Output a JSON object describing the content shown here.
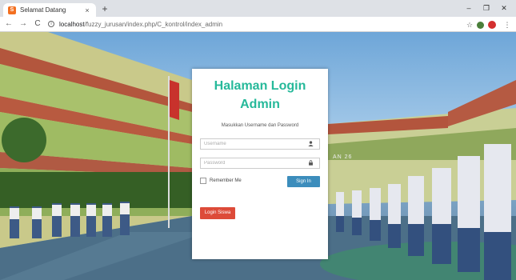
{
  "browser": {
    "tab": {
      "favicon": "S",
      "title": "Selamat Datang",
      "close": "×"
    },
    "new_tab": "+",
    "window": {
      "minimize": "–",
      "maximize": "❐",
      "close": "✕"
    },
    "nav": {
      "back": "←",
      "forward": "→",
      "reload": "C",
      "info": "i"
    },
    "url": {
      "host": "localhost",
      "path": "/fuzzy_jurusan/index.php/C_kontrol/index_admin"
    },
    "icons": {
      "star": "☆",
      "menu": "⋮"
    }
  },
  "login": {
    "title_line1": "Halaman Login",
    "title_line2": "Admin",
    "subtitle": "Masukkan Username dan Password",
    "username_placeholder": "Username",
    "password_placeholder": "Password",
    "remember_label": "Remember Me",
    "signin_label": "Sign In",
    "siswa_label": "Login Siswa",
    "colors": {
      "title": "#26b99a",
      "signin": "#3c8dbc",
      "siswa": "#dd4b39"
    }
  },
  "background": {
    "banner_text": "AN 26"
  }
}
